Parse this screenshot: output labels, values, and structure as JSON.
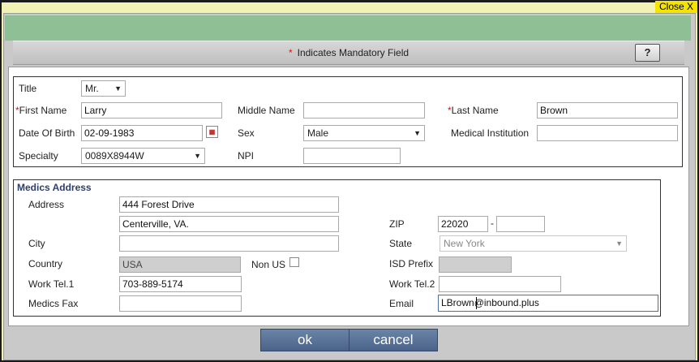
{
  "header": {
    "close_label": "Close X",
    "mandatory_star": "*",
    "mandatory_text": "Indicates Mandatory Field",
    "help_label": "?"
  },
  "personal": {
    "title_label": "Title",
    "title_value": "Mr.",
    "first_name_label": "First Name",
    "first_name_value": "Larry",
    "middle_name_label": "Middle Name",
    "middle_name_value": "",
    "last_name_label": "Last Name",
    "last_name_value": "Brown",
    "dob_label": "Date Of Birth",
    "dob_value": "02-09-1983",
    "sex_label": "Sex",
    "sex_value": "Male",
    "institution_label": "Medical Institution",
    "institution_value": "",
    "specialty_label": "Specialty",
    "specialty_value": "0089X8944W",
    "npi_label": "NPI",
    "npi_value": ""
  },
  "address": {
    "section_title": "Medics Address",
    "address_label": "Address",
    "address_line1": "444 Forest Drive",
    "address_line2": "Centerville, VA.",
    "zip_label": "ZIP",
    "zip_value": "22020",
    "zip_sep": "-",
    "zip_ext": "",
    "city_label": "City",
    "city_value": "",
    "state_label": "State",
    "state_value": "New York",
    "country_label": "Country",
    "country_value": "USA",
    "non_us_label": "Non US",
    "isd_label": "ISD Prefix",
    "isd_value": "",
    "work_tel1_label": "Work Tel.1",
    "work_tel1_value": "703-889-5174",
    "work_tel2_label": "Work Tel.2",
    "work_tel2_value": "",
    "fax_label": "Medics Fax",
    "fax_value": "",
    "email_label": "Email",
    "email_value": "LBrown@inbound.plus"
  },
  "footer": {
    "ok_label": "ok",
    "cancel_label": "cancel"
  },
  "colors": {
    "header_green": "#8fbf94",
    "button_blue": "#56709a",
    "close_yellow": "#f4e400",
    "required_red": "#d11111"
  }
}
